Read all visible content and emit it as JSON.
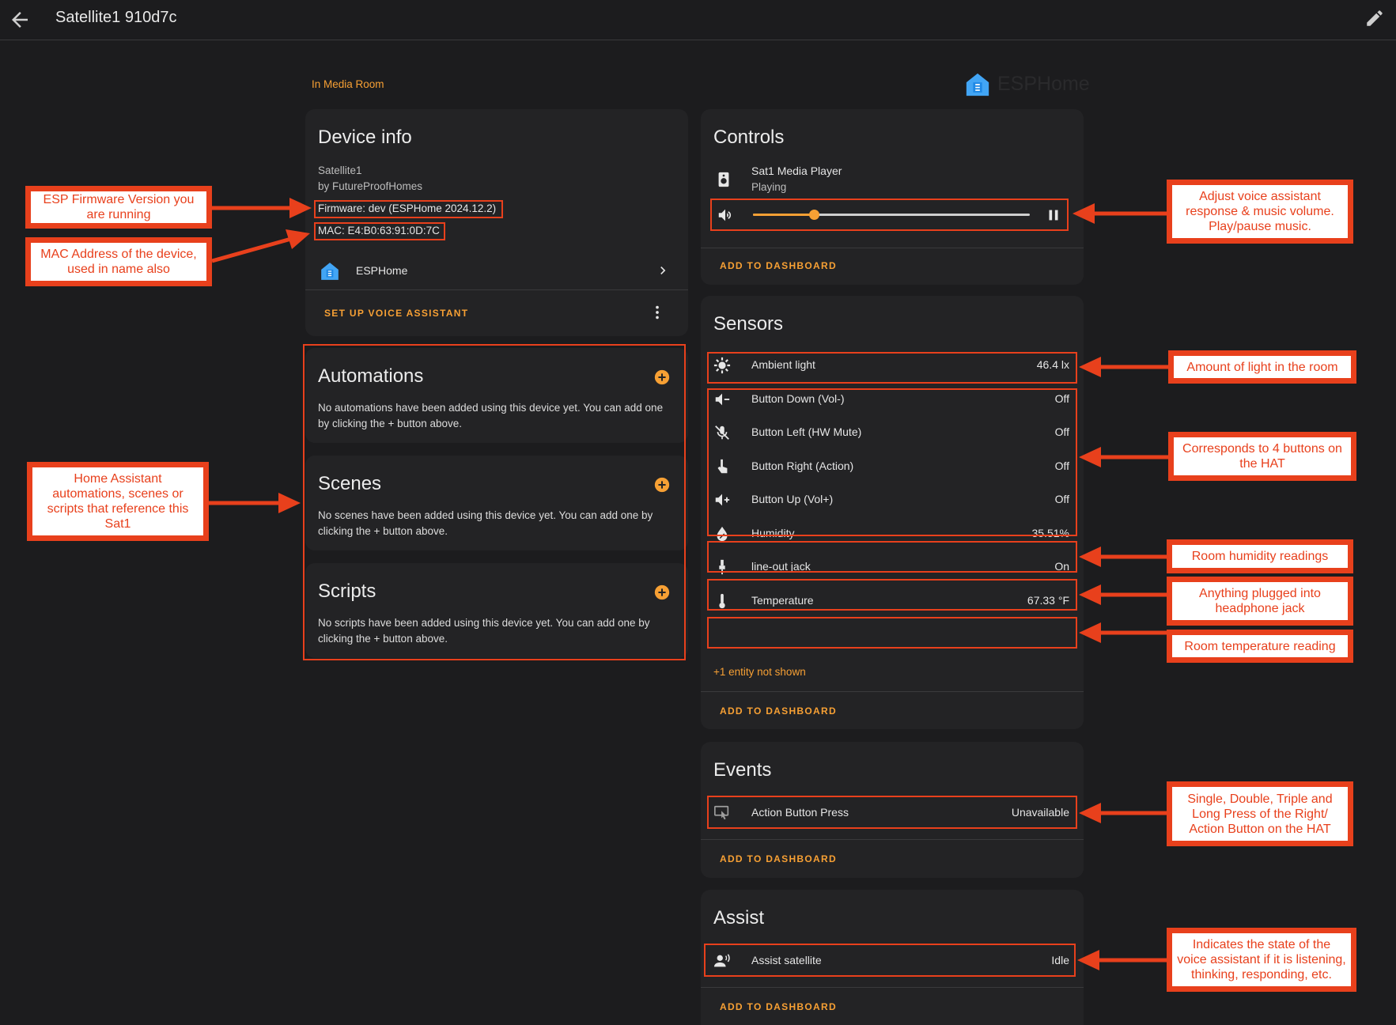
{
  "header": {
    "title": "Satellite1 910d7c"
  },
  "area_label": "In Media Room",
  "brand": {
    "name": "ESPHome"
  },
  "device_info": {
    "title": "Device info",
    "model": "Satellite1",
    "manufacturer": "by FutureProofHomes",
    "firmware": "Firmware: dev (ESPHome 2024.12.2)",
    "mac": "MAC: E4:B0:63:91:0D:7C",
    "integration_label": "ESPHome",
    "setup_button": "SET UP VOICE ASSISTANT"
  },
  "automations": {
    "title": "Automations",
    "text": "No automations have been added using this device yet. You can add one by clicking the + button above."
  },
  "scenes": {
    "title": "Scenes",
    "text": "No scenes have been added using this device yet. You can add one by clicking the + button above."
  },
  "scripts": {
    "title": "Scripts",
    "text": "No scripts have been added using this device yet. You can add one by clicking the + button above."
  },
  "controls": {
    "title": "Controls",
    "media_player": {
      "name": "Sat1 Media Player",
      "state": "Playing",
      "volume": 0.22
    },
    "add_button": "ADD TO DASHBOARD"
  },
  "sensors": {
    "title": "Sensors",
    "rows": [
      {
        "icon": "brightness-icon",
        "name": "Ambient light",
        "state": "46.4 lx"
      },
      {
        "icon": "volume-minus-icon",
        "name": "Button Down (Vol-)",
        "state": "Off"
      },
      {
        "icon": "mic-off-icon",
        "name": "Button Left (HW Mute)",
        "state": "Off"
      },
      {
        "icon": "hand-pointer-icon",
        "name": "Button Right (Action)",
        "state": "Off"
      },
      {
        "icon": "volume-plus-icon",
        "name": "Button Up (Vol+)",
        "state": "Off"
      },
      {
        "icon": "water-percent-icon",
        "name": "Humidity",
        "state": "35.51%"
      },
      {
        "icon": "audio-jack-icon",
        "name": "line-out jack",
        "state": "On"
      },
      {
        "icon": "thermometer-icon",
        "name": "Temperature",
        "state": "67.33 °F"
      }
    ],
    "more_link": "+1 entity not shown",
    "add_button": "ADD TO DASHBOARD"
  },
  "events": {
    "title": "Events",
    "row": {
      "name": "Action Button Press",
      "state": "Unavailable"
    },
    "add_button": "ADD TO DASHBOARD"
  },
  "assist": {
    "title": "Assist",
    "row": {
      "name": "Assist satellite",
      "state": "Idle"
    },
    "add_button": "ADD TO DASHBOARD"
  },
  "callouts": {
    "firmware": "ESP Firmware Version you are running",
    "mac": "MAC Address of the device, used in name also",
    "automations": "Home Assistant automations, scenes or scripts that reference this Sat1",
    "volume": "Adjust voice assistant response & music volume. Play/pause music.",
    "light": "Amount of light in the room",
    "buttons": "Corresponds to 4 buttons on the HAT",
    "humidity": "Room humidity readings",
    "jack": "Anything plugged into headphone jack",
    "temperature": "Room temperature reading",
    "events": "Single, Double, Triple and Long Press of the Right/ Action Button on the HAT",
    "assist": "Indicates the state of the voice assistant if it is listening, thinking, responding, etc."
  },
  "colors": {
    "accent": "#f7a034",
    "annotation": "#e8401c",
    "background": "#1c1c1e",
    "card": "#232325"
  }
}
